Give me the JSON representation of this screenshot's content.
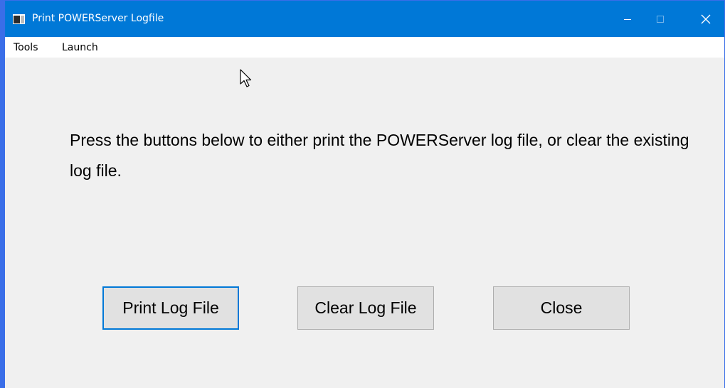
{
  "window": {
    "title": "Print POWERServer Logfile",
    "accent_color": "#0078d7"
  },
  "titlebar_controls": {
    "minimize_icon": "minimize-icon",
    "maximize_icon": "maximize-icon",
    "close_icon": "close-icon"
  },
  "menu": {
    "items": [
      {
        "label": "Tools"
      },
      {
        "label": "Launch"
      }
    ]
  },
  "content": {
    "instructions": "Press the buttons below to either print the POWERServer log file, or clear the existing log file."
  },
  "buttons": {
    "print_label": "Print Log File",
    "clear_label": "Clear Log File",
    "close_label": "Close"
  }
}
